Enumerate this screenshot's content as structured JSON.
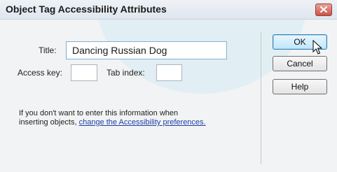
{
  "dialog": {
    "title": "Object Tag Accessibility Attributes",
    "close_icon": "close-x-icon"
  },
  "form": {
    "title_label": "Title:",
    "title_value": "Dancing Russian Dog",
    "access_key_label": "Access key:",
    "access_key_value": "",
    "tab_index_label": "Tab index:",
    "tab_index_value": ""
  },
  "buttons": {
    "ok": "OK",
    "cancel": "Cancel",
    "help": "Help"
  },
  "info": {
    "line1": "If you don't want to enter this information when",
    "line2_prefix": "inserting objects, ",
    "link_text": "change the Accessibility preferences."
  },
  "colors": {
    "titlebar": "#dfe6ee",
    "close_button": "#c9544a",
    "default_button": "#bee6fd",
    "link": "#1f3fa8",
    "background": "#f2f3f4"
  }
}
